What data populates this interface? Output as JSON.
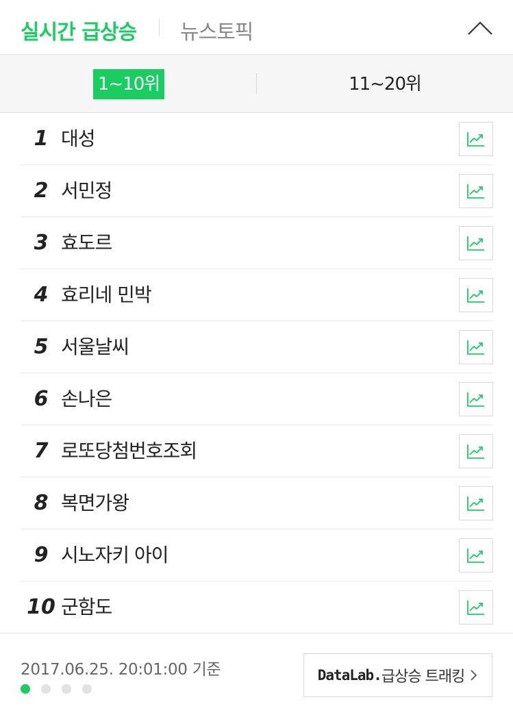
{
  "header": {
    "tab_realtime": "실시간 급상승",
    "tab_news": "뉴스토픽",
    "collapse_icon": "chevron-up-icon"
  },
  "ranges": {
    "active": "1~10위",
    "other": "11~20위"
  },
  "items": [
    {
      "rank": "1",
      "keyword": "대성"
    },
    {
      "rank": "2",
      "keyword": "서민정"
    },
    {
      "rank": "3",
      "keyword": "효도르"
    },
    {
      "rank": "4",
      "keyword": "효리네 민박"
    },
    {
      "rank": "5",
      "keyword": "서울날씨"
    },
    {
      "rank": "6",
      "keyword": "손나은"
    },
    {
      "rank": "7",
      "keyword": "로또당첨번호조회"
    },
    {
      "rank": "8",
      "keyword": "복면가왕"
    },
    {
      "rank": "9",
      "keyword": "시노자키 아이"
    },
    {
      "rank": "10",
      "keyword": "군함도"
    }
  ],
  "footer": {
    "timestamp": "2017.06.25. 20:01:00 기준",
    "page_count": 4,
    "active_page": 1,
    "datalab_brand": "DataLab.",
    "datalab_text": "급상승 트래킹"
  },
  "colors": {
    "accent": "#19ce60",
    "text": "#222222",
    "muted": "#888888"
  }
}
